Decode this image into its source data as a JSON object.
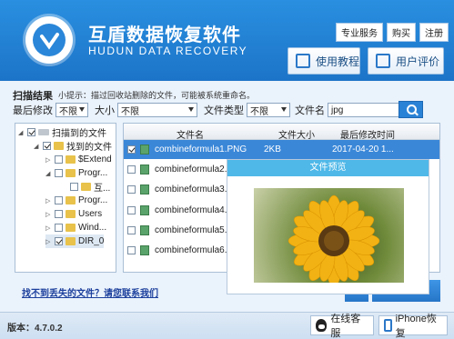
{
  "header": {
    "title_cn": "互盾数据恢复软件",
    "title_en": "HUDUN DATA RECOVERY",
    "top_links": [
      "专业服务",
      "购买",
      "注册"
    ],
    "buttons": [
      "使用教程",
      "用户评价"
    ]
  },
  "scan": {
    "title": "扫描结果",
    "tip": "小提示：描过回收站删除的文件，可能被系统重命名。",
    "filters": {
      "modified_label": "最后修改",
      "modified_value": "不限",
      "size_label": "大小",
      "size_value": "不限",
      "type_label": "文件类型",
      "type_value": "不限",
      "name_label": "文件名",
      "name_value": "jpg"
    }
  },
  "tree": {
    "items": [
      {
        "label": "扫描到的文件"
      },
      {
        "label": "找到的文件"
      },
      {
        "label": "$Extend"
      },
      {
        "label": "Progr..."
      },
      {
        "label": "互..."
      },
      {
        "label": "Progr..."
      },
      {
        "label": "Users"
      },
      {
        "label": "Wind..."
      },
      {
        "label": "DIR_0"
      }
    ]
  },
  "list": {
    "columns": [
      "文件名",
      "文件大小",
      "最后修改时间"
    ],
    "rows": [
      {
        "name": "combineformula1.PNG",
        "size": "2KB",
        "date": "2017-04-20 1..."
      },
      {
        "name": "combineformula2."
      },
      {
        "name": "combineformula3."
      },
      {
        "name": "combineformula4."
      },
      {
        "name": "combineformula5."
      },
      {
        "name": "combineformula6."
      }
    ]
  },
  "preview": {
    "title": "文件预览"
  },
  "help_link": "找不到丢失的文件？请您联系我们",
  "footer": {
    "version": "版本：4.7.0.2",
    "online_service": "在线客服",
    "iphone_recovery": "iPhone恢复"
  },
  "colors": {
    "accent": "#1c74c8",
    "selection": "#3a87d8",
    "preview_bar": "#4fb8e8"
  }
}
